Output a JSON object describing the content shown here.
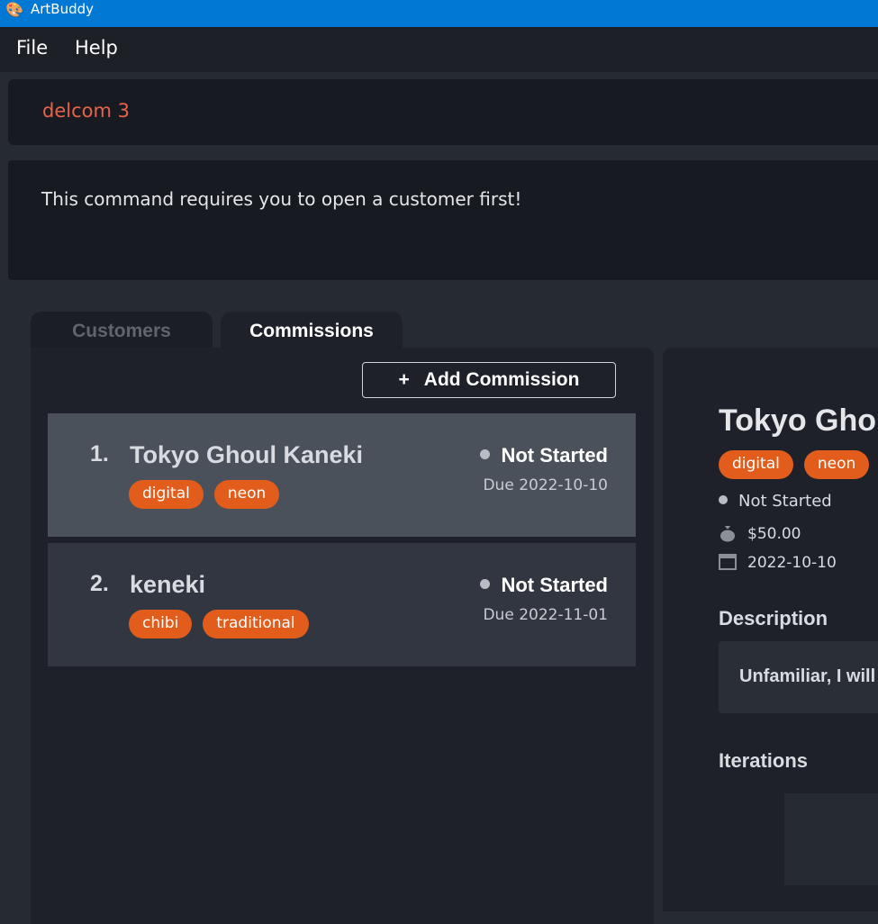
{
  "window": {
    "title": "ArtBuddy",
    "icon": "palette-icon"
  },
  "menu": {
    "file": "File",
    "help": "Help"
  },
  "command": {
    "value": "delcom 3"
  },
  "result": {
    "message": "This command requires you to open a customer first!"
  },
  "tabs": {
    "customers": "Customers",
    "commissions": "Commissions"
  },
  "list": {
    "add_label": "Add Commission",
    "add_icon": "+",
    "commissions": [
      {
        "index": "1.",
        "title": "Tokyo Ghoul Kaneki",
        "tags": [
          "digital",
          "neon"
        ],
        "status": "Not Started",
        "due": "Due 2022-10-10"
      },
      {
        "index": "2.",
        "title": "keneki",
        "tags": [
          "chibi",
          "traditional"
        ],
        "status": "Not Started",
        "due": "Due 2022-11-01"
      }
    ]
  },
  "detail": {
    "title": "Tokyo Ghoul Kaneki",
    "tags": [
      "digital",
      "neon"
    ],
    "status": "Not Started",
    "fee": "$50.00",
    "due_date": "2022-10-10",
    "description_heading": "Description",
    "description": "Unfamiliar, I will draw it",
    "iterations_heading": "Iterations"
  },
  "colors": {
    "accent": "#0078d4",
    "tag": "#e25d1c",
    "command_text": "#e8634a"
  }
}
